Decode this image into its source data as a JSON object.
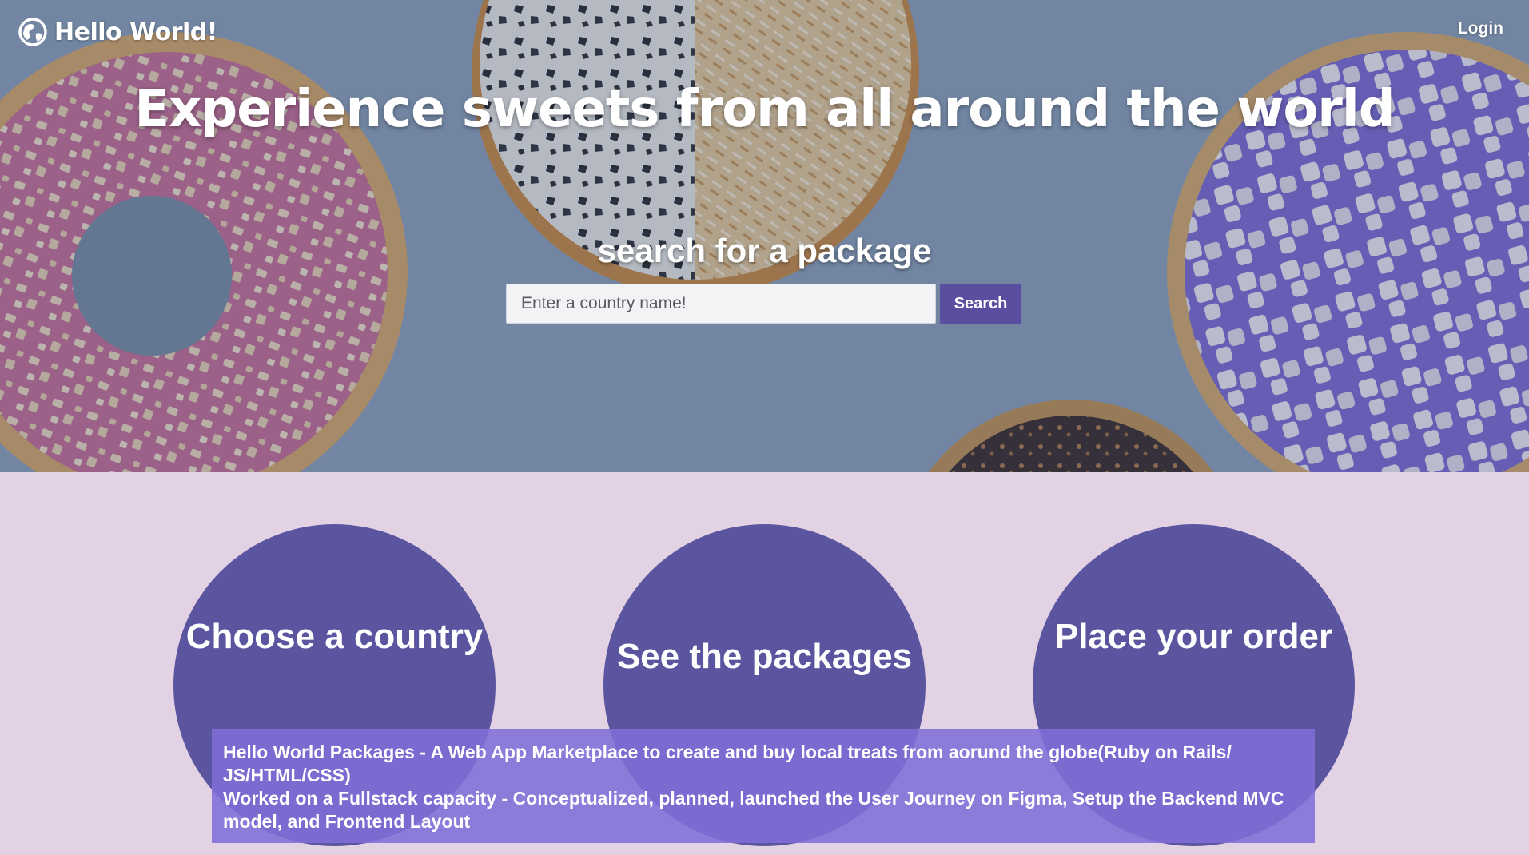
{
  "header": {
    "brand": "Hello World!",
    "brand_icon": "globe-icon",
    "login_label": "Login"
  },
  "hero": {
    "title": "Experience sweets from all around the world",
    "search_heading": "search for a package",
    "search_placeholder": "Enter a country name!",
    "search_button_label": "Search"
  },
  "steps": [
    {
      "label": "Choose a country"
    },
    {
      "label": "See the packages"
    },
    {
      "label": "Place your order"
    }
  ],
  "caption": {
    "line1": "Hello World Packages - A Web App Marketplace to create and buy local treats from aorund the globe(Ruby on Rails/ JS/HTML/CSS)",
    "line2": "Worked on a Fullstack capacity - Conceptualized, planned, launched the User Journey on Figma, Setup the Backend MVC model, and Frontend Layout"
  },
  "colors": {
    "accent": "#5a4ea0",
    "circle": "#5b55a0",
    "section_bg": "#e2d2e3",
    "caption_bg": "#806ed7"
  }
}
